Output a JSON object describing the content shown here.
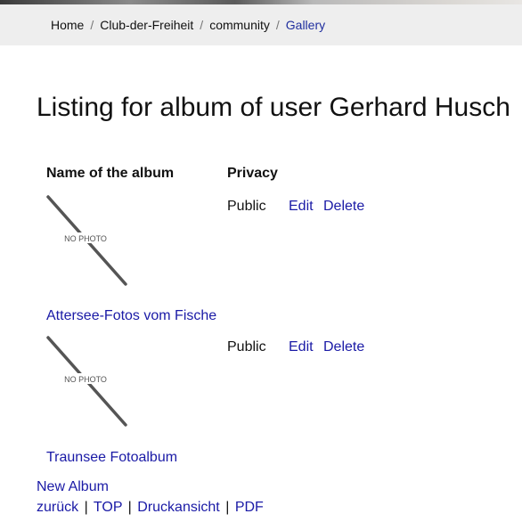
{
  "breadcrumb": {
    "items": [
      "Home",
      "Club-der-Freiheit",
      "community"
    ],
    "current": "Gallery",
    "separator": "/"
  },
  "page_title": "Listing for album of user Gerhard Husch",
  "table": {
    "headers": {
      "name": "Name of the album",
      "privacy": "Privacy"
    },
    "rows": [
      {
        "thumbnail_text": "NO PHOTO",
        "title": "Attersee-Fotos vom Fische",
        "privacy": "Public",
        "edit": "Edit",
        "delete": "Delete"
      },
      {
        "thumbnail_text": "NO PHOTO",
        "title": "Traunsee Fotoalbum",
        "privacy": "Public",
        "edit": "Edit",
        "delete": "Delete"
      }
    ]
  },
  "new_album": "New Album",
  "footer": {
    "back": "zurück",
    "top": "TOP",
    "print": "Druckansicht",
    "pdf": "PDF",
    "separator": "|"
  },
  "colors": {
    "link": "#1a1aa6",
    "breadcrumb_bar": "#eeeeee"
  }
}
